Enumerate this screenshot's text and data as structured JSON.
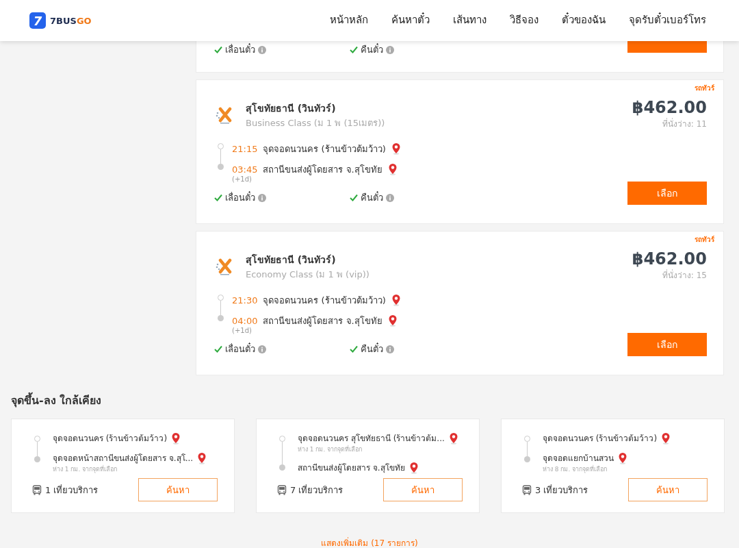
{
  "header": {
    "logo": {
      "mark": "7",
      "name": "7BUS",
      "name_accent": "GO"
    },
    "nav": [
      {
        "label": "หน้าหลัก",
        "selected": false
      },
      {
        "label": "ค้นหาตั๋ว",
        "selected": false
      },
      {
        "label": "เส้นทาง",
        "selected": false
      },
      {
        "label": "วิธีจอง",
        "selected": false
      },
      {
        "label": "ตั๋วของฉัน",
        "selected": false
      },
      {
        "label": "จุดรับตั๋วเบอร์โทร",
        "selected": false
      }
    ]
  },
  "partial_trip": {
    "features": [
      {
        "label": "เลื่อนตั๋ว",
        "available": true
      },
      {
        "label": "คืนตั๋ว",
        "available": true
      }
    ]
  },
  "trips": [
    {
      "badge": "รถทัวร์",
      "operator": "สุโขทัยธานี (วินทัวร์)",
      "bus_class": "Business Class (ม 1 พ (15เมตร))",
      "price": "฿462.00",
      "seats": "ที่นั่งว่าง: 11",
      "stops": [
        {
          "time": "21:15",
          "place": "จุดจอดนวนคร (ร้านข้าวต้มว้าว)"
        },
        {
          "time": "03:45",
          "place": "สถานีขนส่งผู้โดยสาร จ.สุโขทัย",
          "day_offset": "(+1d)"
        }
      ],
      "features": [
        {
          "label": "เลื่อนตั๋ว",
          "available": true
        },
        {
          "label": "คืนตั๋ว",
          "available": true
        }
      ],
      "button": "เลือก"
    },
    {
      "badge": "รถทัวร์",
      "operator": "สุโขทัยธานี (วินทัวร์)",
      "bus_class": "Economy Class (ม 1 พ (vip))",
      "price": "฿462.00",
      "seats": "ที่นั่งว่าง: 15",
      "stops": [
        {
          "time": "21:30",
          "place": "จุดจอดนวนคร (ร้านข้าวต้มว้าว)"
        },
        {
          "time": "04:00",
          "place": "สถานีขนส่งผู้โดยสาร จ.สุโขทัย",
          "day_offset": "(+1d)"
        }
      ],
      "features": [
        {
          "label": "เลื่อนตั๋ว",
          "available": true
        },
        {
          "label": "คืนตั๋ว",
          "available": true
        }
      ],
      "button": "เลือก"
    }
  ],
  "nearby": {
    "title": "จุดขึ้น-ลง ใกล้เคียง",
    "cards": [
      {
        "stops": [
          {
            "name": "จุดจอดนวนคร (ร้านข้าวต้มว้าว)"
          },
          {
            "name": "จุดจอดหน้าสถานีขนส่งผู้โดยสาร จ.สุโ...",
            "distance": "ห่าง 1 กม. จากจุดที่เลือก"
          }
        ],
        "trips": "1 เที่ยวบริการ",
        "button": "ค้นหา"
      },
      {
        "stops": [
          {
            "name": "จุดจอดนวนคร สุโขทัยธานี (ร้านข้าวต้ม...",
            "distance": "ห่าง 1 กม. จากจุดที่เลือก"
          },
          {
            "name": "สถานีขนส่งผู้โดยสาร จ.สุโขทัย"
          }
        ],
        "trips": "7 เที่ยวบริการ",
        "button": "ค้นหา"
      },
      {
        "stops": [
          {
            "name": "จุดจอดนวนคร (ร้านข้าวต้มว้าว)"
          },
          {
            "name": "จุดจอดแยกบ้านสวน",
            "distance": "ห่าง 8 กม. จากจุดที่เลือก"
          }
        ],
        "trips": "3 เที่ยวบริการ",
        "button": "ค้นหา"
      }
    ],
    "show_more": "แสดงเพิ่มเติม (17 รายการ)"
  }
}
